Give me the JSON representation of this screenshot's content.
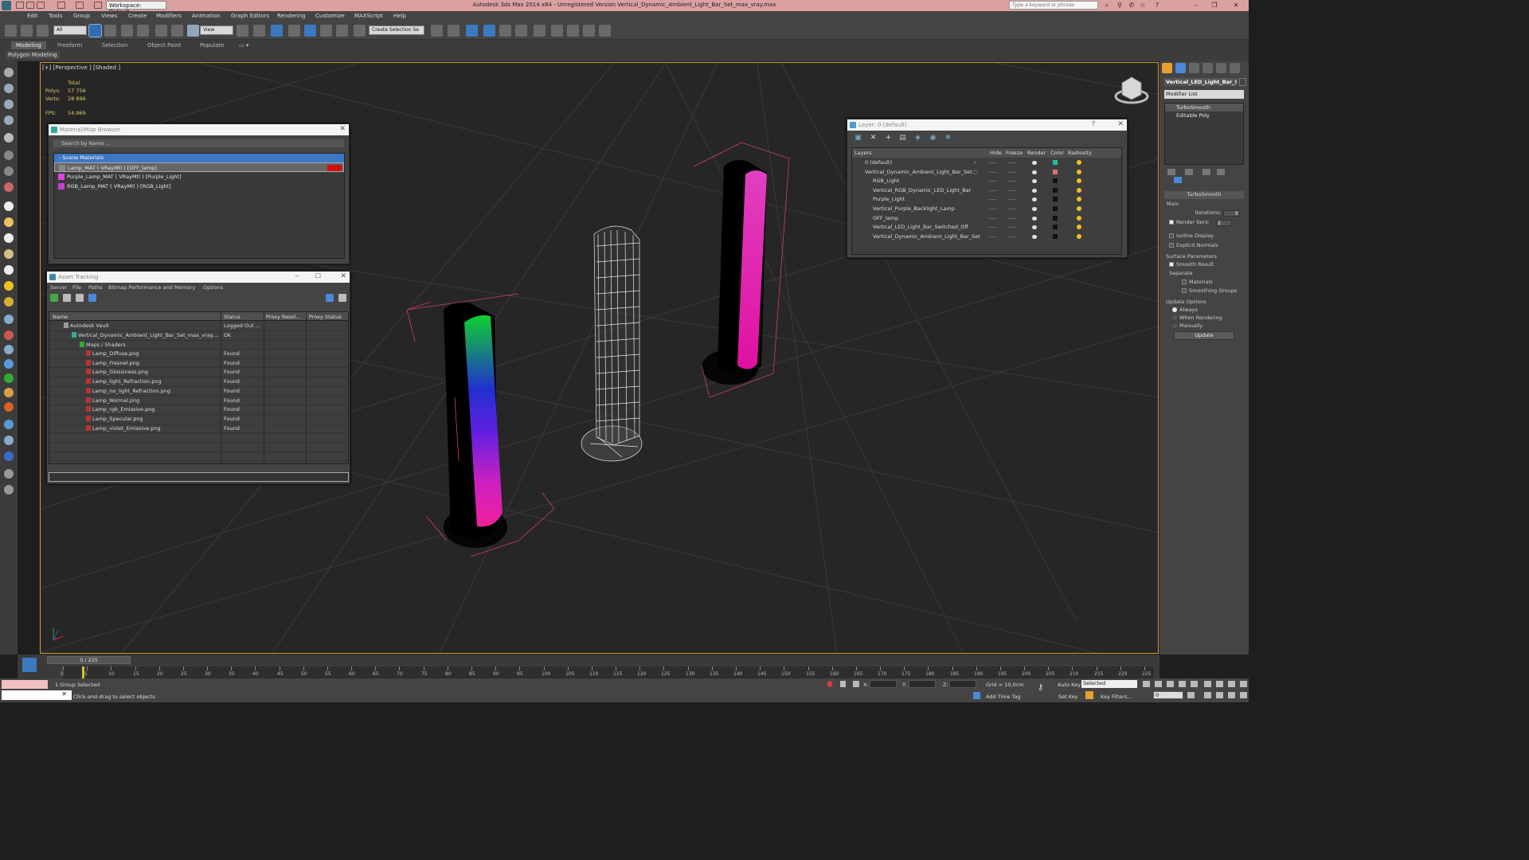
{
  "titlebar": {
    "workspace": "Workspace: Default",
    "title": "Autodesk 3ds Max  2014 x64  -  Unregistered Version    Vertical_Dynamic_Ambient_Light_Bar_Set_max_vray.max",
    "search_placeholder": "Type a keyword or phrase",
    "bg_color": "#dba0a0"
  },
  "menu": [
    "Edit",
    "Tools",
    "Group",
    "Views",
    "Create",
    "Modifiers",
    "Animation",
    "Graph Editors",
    "Rendering",
    "Customize",
    "MAXScript",
    "Help"
  ],
  "toolbar": {
    "filter": "All",
    "ref_coord": "View",
    "selection_set": "Create Selection Se"
  },
  "ribbon": {
    "tabs": [
      "Modeling",
      "Freeform",
      "Selection",
      "Object Paint",
      "Populate"
    ],
    "active_tab": "Modeling",
    "sub_label": "Polygon Modeling"
  },
  "viewport": {
    "label": "[+] [Perspective ] [Shaded ]",
    "stats_header": "Total",
    "polys_label": "Polys:",
    "polys": "57 756",
    "verts_label": "Verts:",
    "verts": "28 896",
    "fps_label": "FPS:",
    "fps": "54,969",
    "border_color": "#c8a232"
  },
  "material_browser": {
    "title": "Material/Map Browser",
    "search_placeholder": "Search by Name ...",
    "group": "- Scene Materials",
    "items": [
      {
        "label": "Lamp_MAT  ( VRayMtl )  [OFF_lamp]",
        "swatch": "#888888"
      },
      {
        "label": "Purple_Lamp_MAT  ( VRayMtl )  [Purple_Light]",
        "swatch": "#e040e0"
      },
      {
        "label": "RGB_Lamp_MAT  ( VRayMtl )  [RGB_Light]",
        "swatch": "#c040d0"
      }
    ]
  },
  "asset_tracking": {
    "title": "Asset Tracking",
    "menu": [
      "Server",
      "File",
      "Paths",
      "Bitmap Performance and Memory",
      "Options"
    ],
    "columns": [
      "Name",
      "Status",
      "Proxy Resol...",
      "Proxy Status"
    ],
    "rows": [
      {
        "name": "Autodesk Vault",
        "status": "Logged Out ...",
        "indent": 0
      },
      {
        "name": "Vertical_Dynamic_Ambient_Light_Bar_Set_max_vray....",
        "status": "Ok",
        "indent": 1
      },
      {
        "name": "Maps / Shaders",
        "status": "",
        "indent": 2
      },
      {
        "name": "Lamp_Diffuse.png",
        "status": "Found",
        "indent": 3
      },
      {
        "name": "Lamp_Fresnel.png",
        "status": "Found",
        "indent": 3
      },
      {
        "name": "Lamp_Glossiness.png",
        "status": "Found",
        "indent": 3
      },
      {
        "name": "Lamp_light_Refraction.png",
        "status": "Found",
        "indent": 3
      },
      {
        "name": "Lamp_no_light_Refraction.png",
        "status": "Found",
        "indent": 3
      },
      {
        "name": "Lamp_Normal.png",
        "status": "Found",
        "indent": 3
      },
      {
        "name": "Lamp_rgb_Emissive.png",
        "status": "Found",
        "indent": 3
      },
      {
        "name": "Lamp_Specular.png",
        "status": "Found",
        "indent": 3
      },
      {
        "name": "Lamp_violet_Emissive.png",
        "status": "Found",
        "indent": 3
      }
    ]
  },
  "layers": {
    "title": "Layer: 0 (default)",
    "columns": [
      "Layers",
      "Hide",
      "Freeze",
      "Render",
      "Color",
      "Radiosity"
    ],
    "rows": [
      {
        "name": "0 (default)",
        "color": "#20c0a0",
        "indent": 0
      },
      {
        "name": "Vertical_Dynamic_Ambient_Light_Bar_Set",
        "color": "#e07070",
        "indent": 0
      },
      {
        "name": "RGB_Light",
        "color": "#111111",
        "indent": 1
      },
      {
        "name": "Vertical_RGB_Dynamic_LED_Light_Bar",
        "color": "#111111",
        "indent": 1
      },
      {
        "name": "Purple_Light",
        "color": "#111111",
        "indent": 1
      },
      {
        "name": "Vertical_Purple_Backlight_Lamp",
        "color": "#111111",
        "indent": 1
      },
      {
        "name": "OFF_lamp",
        "color": "#111111",
        "indent": 1
      },
      {
        "name": "Vertical_LED_Light_Bar_Switched_Off",
        "color": "#111111",
        "indent": 1
      },
      {
        "name": "Vertical_Dynamic_Ambient_Light_Bar_Set",
        "color": "#111111",
        "indent": 1
      }
    ],
    "dash": "----"
  },
  "command_panel": {
    "object_name": "Vertical_LED_Light_Bar_!",
    "modifier_list": "Modifier List",
    "stack": [
      "TurboSmooth",
      "Editable Poly"
    ],
    "turbosmooth": {
      "header": "TurboSmooth",
      "main": "Main",
      "iterations_label": "Iterations:",
      "iterations": "0",
      "render_iters_label": "Render Iters:",
      "render_iters": "2",
      "isoline": "Isoline Display",
      "explicit": "Explicit Normals",
      "surface_header": "Surface Parameters",
      "smooth_result": "Smooth Result",
      "separate": "Separate",
      "materials": "Materials",
      "smoothing_groups": "Smoothing Groups",
      "update_options": "Update Options",
      "always": "Always",
      "when_rendering": "When Rendering",
      "manually": "Manually",
      "update": "Update"
    }
  },
  "timeline": {
    "slider": "0 / 225",
    "ticks": [
      "0",
      "5",
      "10",
      "15",
      "20",
      "25",
      "30",
      "35",
      "40",
      "45",
      "50",
      "55",
      "60",
      "65",
      "70",
      "75",
      "80",
      "85",
      "90",
      "95",
      "100",
      "105",
      "110",
      "115",
      "120",
      "125",
      "130",
      "135",
      "140",
      "145",
      "150",
      "155",
      "160",
      "165",
      "170",
      "175",
      "180",
      "185",
      "190",
      "195",
      "200",
      "205",
      "210",
      "215",
      "220",
      "225"
    ]
  },
  "status": {
    "selection": "1 Group Selected",
    "prompt": "Click-and-drag to select objects",
    "x_label": "X:",
    "y_label": "Y:",
    "z_label": "Z:",
    "grid": "Grid = 10,0cm",
    "add_time_tag": "Add Time Tag",
    "auto_key": "Auto Key",
    "set_key": "Set Key",
    "selected": "Selected",
    "key_filters": "Key Filters...",
    "frame": "0"
  }
}
